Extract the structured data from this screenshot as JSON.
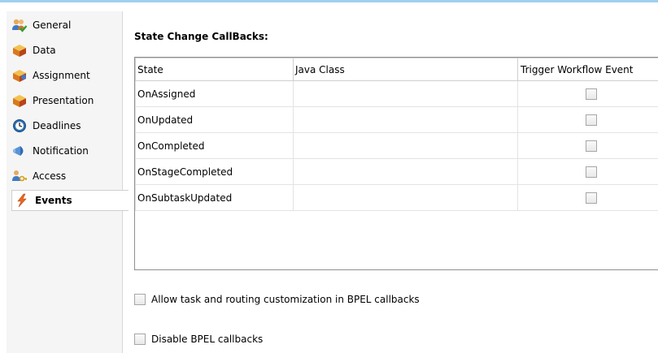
{
  "sidebar": {
    "items": [
      {
        "label": "General",
        "icon": "people-check-icon"
      },
      {
        "label": "Data",
        "icon": "data-cube-icon"
      },
      {
        "label": "Assignment",
        "icon": "assignment-icon"
      },
      {
        "label": "Presentation",
        "icon": "presentation-icon"
      },
      {
        "label": "Deadlines",
        "icon": "clock-icon"
      },
      {
        "label": "Notification",
        "icon": "megaphone-icon"
      },
      {
        "label": "Access",
        "icon": "access-key-icon"
      },
      {
        "label": "Events",
        "icon": "lightning-icon",
        "active": true
      }
    ]
  },
  "main": {
    "title": "State Change CallBacks:",
    "table": {
      "columns": [
        "State",
        "Java Class",
        "Trigger Workflow Event"
      ],
      "rows": [
        {
          "state": "OnAssigned",
          "java_class": "",
          "trigger": false
        },
        {
          "state": "OnUpdated",
          "java_class": "",
          "trigger": false
        },
        {
          "state": "OnCompleted",
          "java_class": "",
          "trigger": false
        },
        {
          "state": "OnStageCompleted",
          "java_class": "",
          "trigger": false
        },
        {
          "state": "OnSubtaskUpdated",
          "java_class": "",
          "trigger": false
        }
      ]
    },
    "options": {
      "allow_customization": {
        "label": "Allow task and routing customization in BPEL callbacks",
        "checked": false
      },
      "disable_callbacks": {
        "label": "Disable BPEL callbacks",
        "checked": false
      }
    }
  },
  "colors": {
    "accent_line": "#9fd0ef",
    "sidebar_bg": "#f5f5f5",
    "grid": "#e3e3e3"
  }
}
